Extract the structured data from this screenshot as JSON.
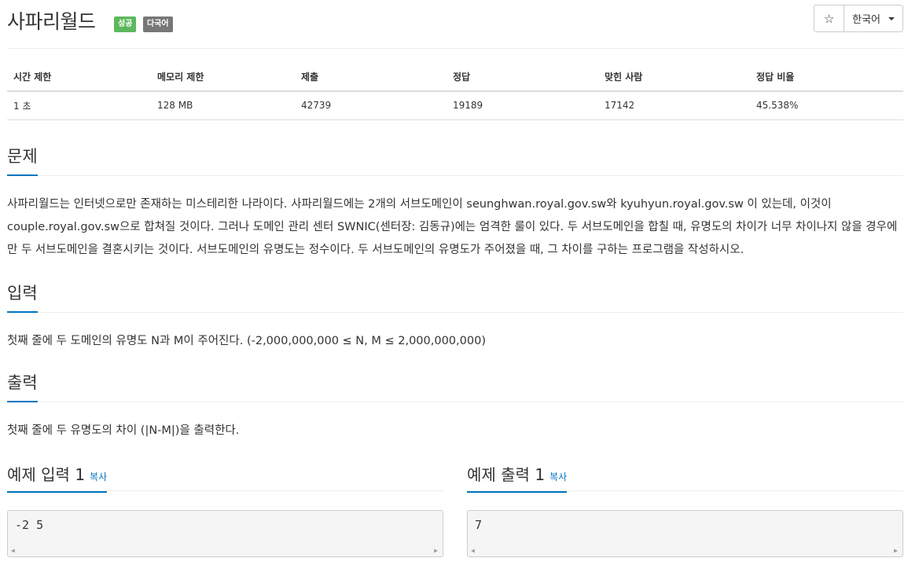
{
  "header": {
    "title": "사파리월드",
    "badge_success": "성공",
    "badge_lang": "다국어",
    "star": "☆",
    "language": "한국어"
  },
  "info": {
    "headers": [
      "시간 제한",
      "메모리 제한",
      "제출",
      "정답",
      "맞힌 사람",
      "정답 비율"
    ],
    "values": [
      "1 초",
      "128 MB",
      "42739",
      "19189",
      "17142",
      "45.538%"
    ]
  },
  "problem": {
    "title": "문제",
    "body": "사파리월드는 인터넷으로만 존재하는 미스테리한 나라이다. 사파리월드에는 2개의 서브도메인이 seunghwan.royal.gov.sw와 kyuhyun.royal.gov.sw 이 있는데, 이것이 couple.royal.gov.sw으로 합쳐질 것이다. 그러나 도메인 관리 센터 SWNIC(센터장: 김동규)에는 엄격한 룰이 있다. 두 서브도메인을 합칠 때, 유명도의 차이가 너무 차이나지 않을 경우에만 두 서브도메인을 결혼시키는 것이다. 서브도메인의 유명도는 정수이다. 두 서브도메인의 유명도가 주어졌을 때, 그 차이를 구하는 프로그램을 작성하시오."
  },
  "input": {
    "title": "입력",
    "body": "첫째 줄에 두 도메인의 유명도 N과 M이 주어진다. (-2,000,000,000 ≤ N, M ≤ 2,000,000,000)"
  },
  "output": {
    "title": "출력",
    "body": "첫째 줄에 두 유명도의 차이 (|N-M|)을 출력한다."
  },
  "sample_input": {
    "title": "예제 입력 1",
    "copy": "복사",
    "content": "-2 5"
  },
  "sample_output": {
    "title": "예제 출력 1",
    "copy": "복사",
    "content": "7"
  }
}
